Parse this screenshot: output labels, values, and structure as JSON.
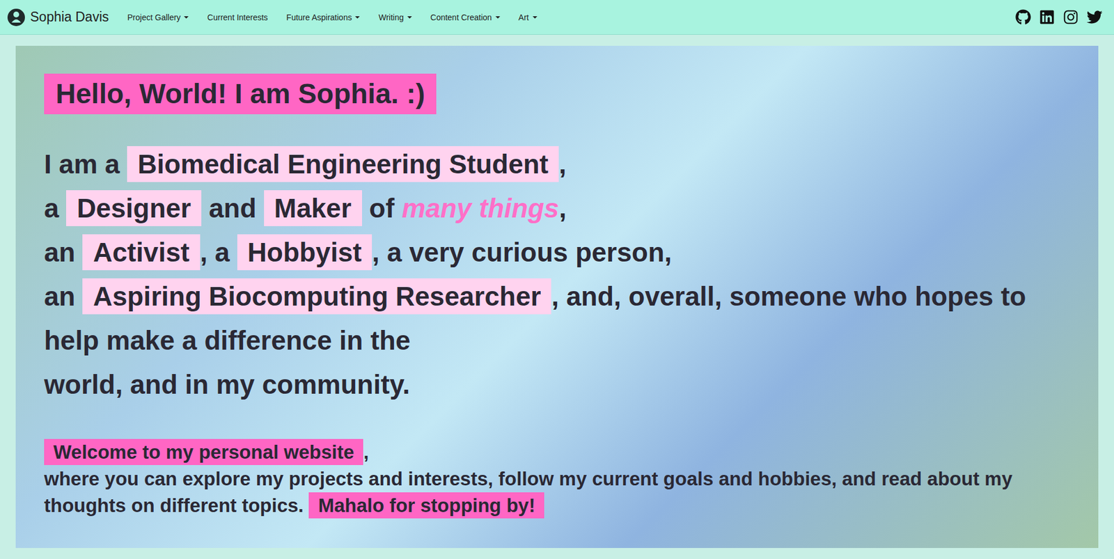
{
  "navbar": {
    "brand": "Sophia Davis",
    "items": [
      {
        "label": "Project Gallery",
        "dropdown": true
      },
      {
        "label": "Current Interests",
        "dropdown": false
      },
      {
        "label": "Future Aspirations",
        "dropdown": true
      },
      {
        "label": "Writing",
        "dropdown": true
      },
      {
        "label": "Content Creation",
        "dropdown": true
      },
      {
        "label": "Art",
        "dropdown": true
      }
    ],
    "social": [
      {
        "name": "github"
      },
      {
        "name": "linkedin"
      },
      {
        "name": "instagram"
      },
      {
        "name": "twitter"
      }
    ]
  },
  "hero": {
    "greeting": "Hello, World! I am Sophia. :)",
    "intro": [
      [
        {
          "text": "I am a ",
          "kind": "plain"
        },
        {
          "text": "Biomedical Engineering Student",
          "kind": "chip"
        },
        {
          "text": ",",
          "kind": "plain"
        }
      ],
      [
        {
          "text": "a ",
          "kind": "plain"
        },
        {
          "text": "Designer",
          "kind": "chip"
        },
        {
          "text": " and ",
          "kind": "plain"
        },
        {
          "text": "Maker",
          "kind": "chip"
        },
        {
          "text": " of ",
          "kind": "plain"
        },
        {
          "text": "many things",
          "kind": "accent"
        },
        {
          "text": ",",
          "kind": "plain"
        }
      ],
      [
        {
          "text": "an ",
          "kind": "plain"
        },
        {
          "text": "Activist",
          "kind": "chip"
        },
        {
          "text": ", a ",
          "kind": "plain"
        },
        {
          "text": "Hobbyist",
          "kind": "chip"
        },
        {
          "text": ", a very curious person,",
          "kind": "plain"
        }
      ],
      [
        {
          "text": "an ",
          "kind": "plain"
        },
        {
          "text": "Aspiring Biocomputing Researcher",
          "kind": "chip"
        },
        {
          "text": ", and, overall, someone who hopes to help make a difference in the",
          "kind": "plain"
        }
      ],
      [
        {
          "text": "world, and in my community.",
          "kind": "plain"
        }
      ]
    ],
    "welcome": [
      [
        {
          "text": "Welcome to my personal website",
          "kind": "highlight"
        },
        {
          "text": ",",
          "kind": "plain"
        }
      ],
      [
        {
          "text": "where you can explore my projects and interests, follow my current goals and hobbies, and read about my thoughts on different topics. ",
          "kind": "plain"
        },
        {
          "text": "Mahalo for stopping by!",
          "kind": "highlight"
        }
      ]
    ]
  }
}
